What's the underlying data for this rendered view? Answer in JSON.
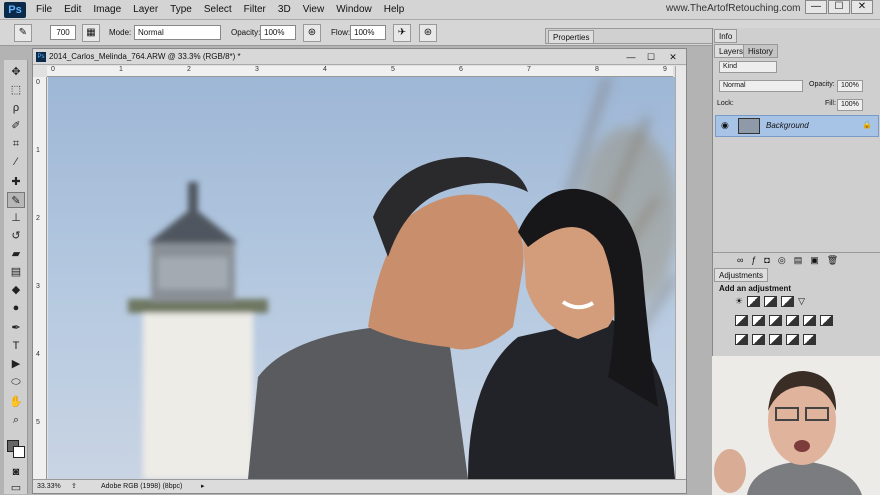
{
  "app": {
    "logo": "Ps",
    "watermark": "www.TheArtofRetouching.com"
  },
  "menu": [
    "File",
    "Edit",
    "Image",
    "Layer",
    "Type",
    "Select",
    "Filter",
    "3D",
    "View",
    "Window",
    "Help"
  ],
  "window_controls": [
    "—",
    "☐",
    "✕"
  ],
  "options_bar": {
    "brush_size": "700",
    "mode_label": "Mode:",
    "mode_value": "Normal",
    "opacity_label": "Opacity:",
    "opacity_value": "100%",
    "flow_label": "Flow:",
    "flow_value": "100%"
  },
  "document": {
    "title": "2014_Carlos_Melinda_764.ARW @ 33.3% (RGB/8*) *",
    "zoom": "33.33%",
    "profile": "Adobe RGB (1998) (8bpc)",
    "ruler_h": [
      "0",
      "1",
      "2",
      "3",
      "4",
      "5",
      "6",
      "7",
      "8",
      "9"
    ],
    "ruler_v": [
      "0",
      "1",
      "2",
      "3",
      "4",
      "5"
    ]
  },
  "properties": {
    "tab": "Properties"
  },
  "info": {
    "tab": "Info"
  },
  "layers": {
    "tab": "Layers",
    "history_tab": "History",
    "kind": "Kind",
    "blend": "Normal",
    "opacity_label": "Opacity:",
    "opacity_value": "100%",
    "lock_label": "Lock:",
    "fill_label": "Fill:",
    "fill_value": "100%",
    "layer_name": "Background"
  },
  "adjustments": {
    "tab": "Adjustments",
    "title": "Add an adjustment"
  }
}
